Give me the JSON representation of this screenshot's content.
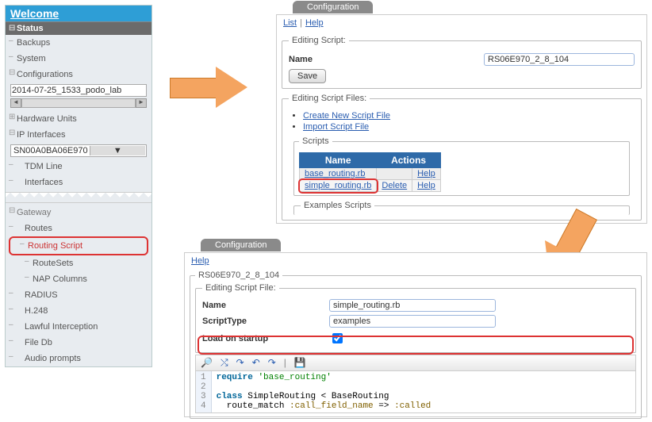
{
  "sidebar": {
    "welcome": "Welcome",
    "status": "Status",
    "backups": "Backups",
    "system": "System",
    "configs": "Configurations",
    "configSelected": "2014-07-25_1533_podo_lab",
    "hw": "Hardware Units",
    "ip": "IP Interfaces",
    "ipSelected": "SN00A0BA06E970",
    "tdm": "TDM Line",
    "interfaces": "Interfaces",
    "gateway": "Gateway",
    "routes": "Routes",
    "routingScript": "Routing Script",
    "routeSets": "RouteSets",
    "napCols": "NAP Columns",
    "radius": "RADIUS",
    "h248": "H.248",
    "lawful": "Lawful Interception",
    "fileDb": "File Db",
    "audio": "Audio prompts"
  },
  "topPanel": {
    "tab": "Configuration",
    "crumbList": "List",
    "crumbHelp": "Help",
    "editingScript": "Editing Script:",
    "nameLabel": "Name",
    "nameValue": "RS06E970_2_8_104",
    "save": "Save",
    "editingFiles": "Editing Script Files:",
    "createNew": "Create New Script File",
    "importFile": "Import Script File",
    "scriptsLegend": "Scripts",
    "thName": "Name",
    "thActions": "Actions",
    "rows": [
      {
        "name": "base_routing.rb",
        "delete": "",
        "help": "Help"
      },
      {
        "name": "simple_routing.rb",
        "delete": "Delete",
        "help": "Help"
      }
    ],
    "examples": "Examples Scripts"
  },
  "bottomPanel": {
    "tab": "Configuration",
    "help": "Help",
    "outerLegend": "RS06E970_2_8_104",
    "innerLegend": "Editing Script File:",
    "nameLabel": "Name",
    "nameValue": "simple_routing.rb",
    "typeLabel": "ScriptType",
    "typeValue": "examples",
    "loadLabel": "Load on startup",
    "code": {
      "l1": "require 'base_routing'",
      "l2": "",
      "l3a": "class",
      "l3b": " SimpleRouting < BaseRouting",
      "l4a": "  route_match ",
      "l4b": ":call_field_name",
      "l4c": " => ",
      "l4d": ":called"
    }
  }
}
